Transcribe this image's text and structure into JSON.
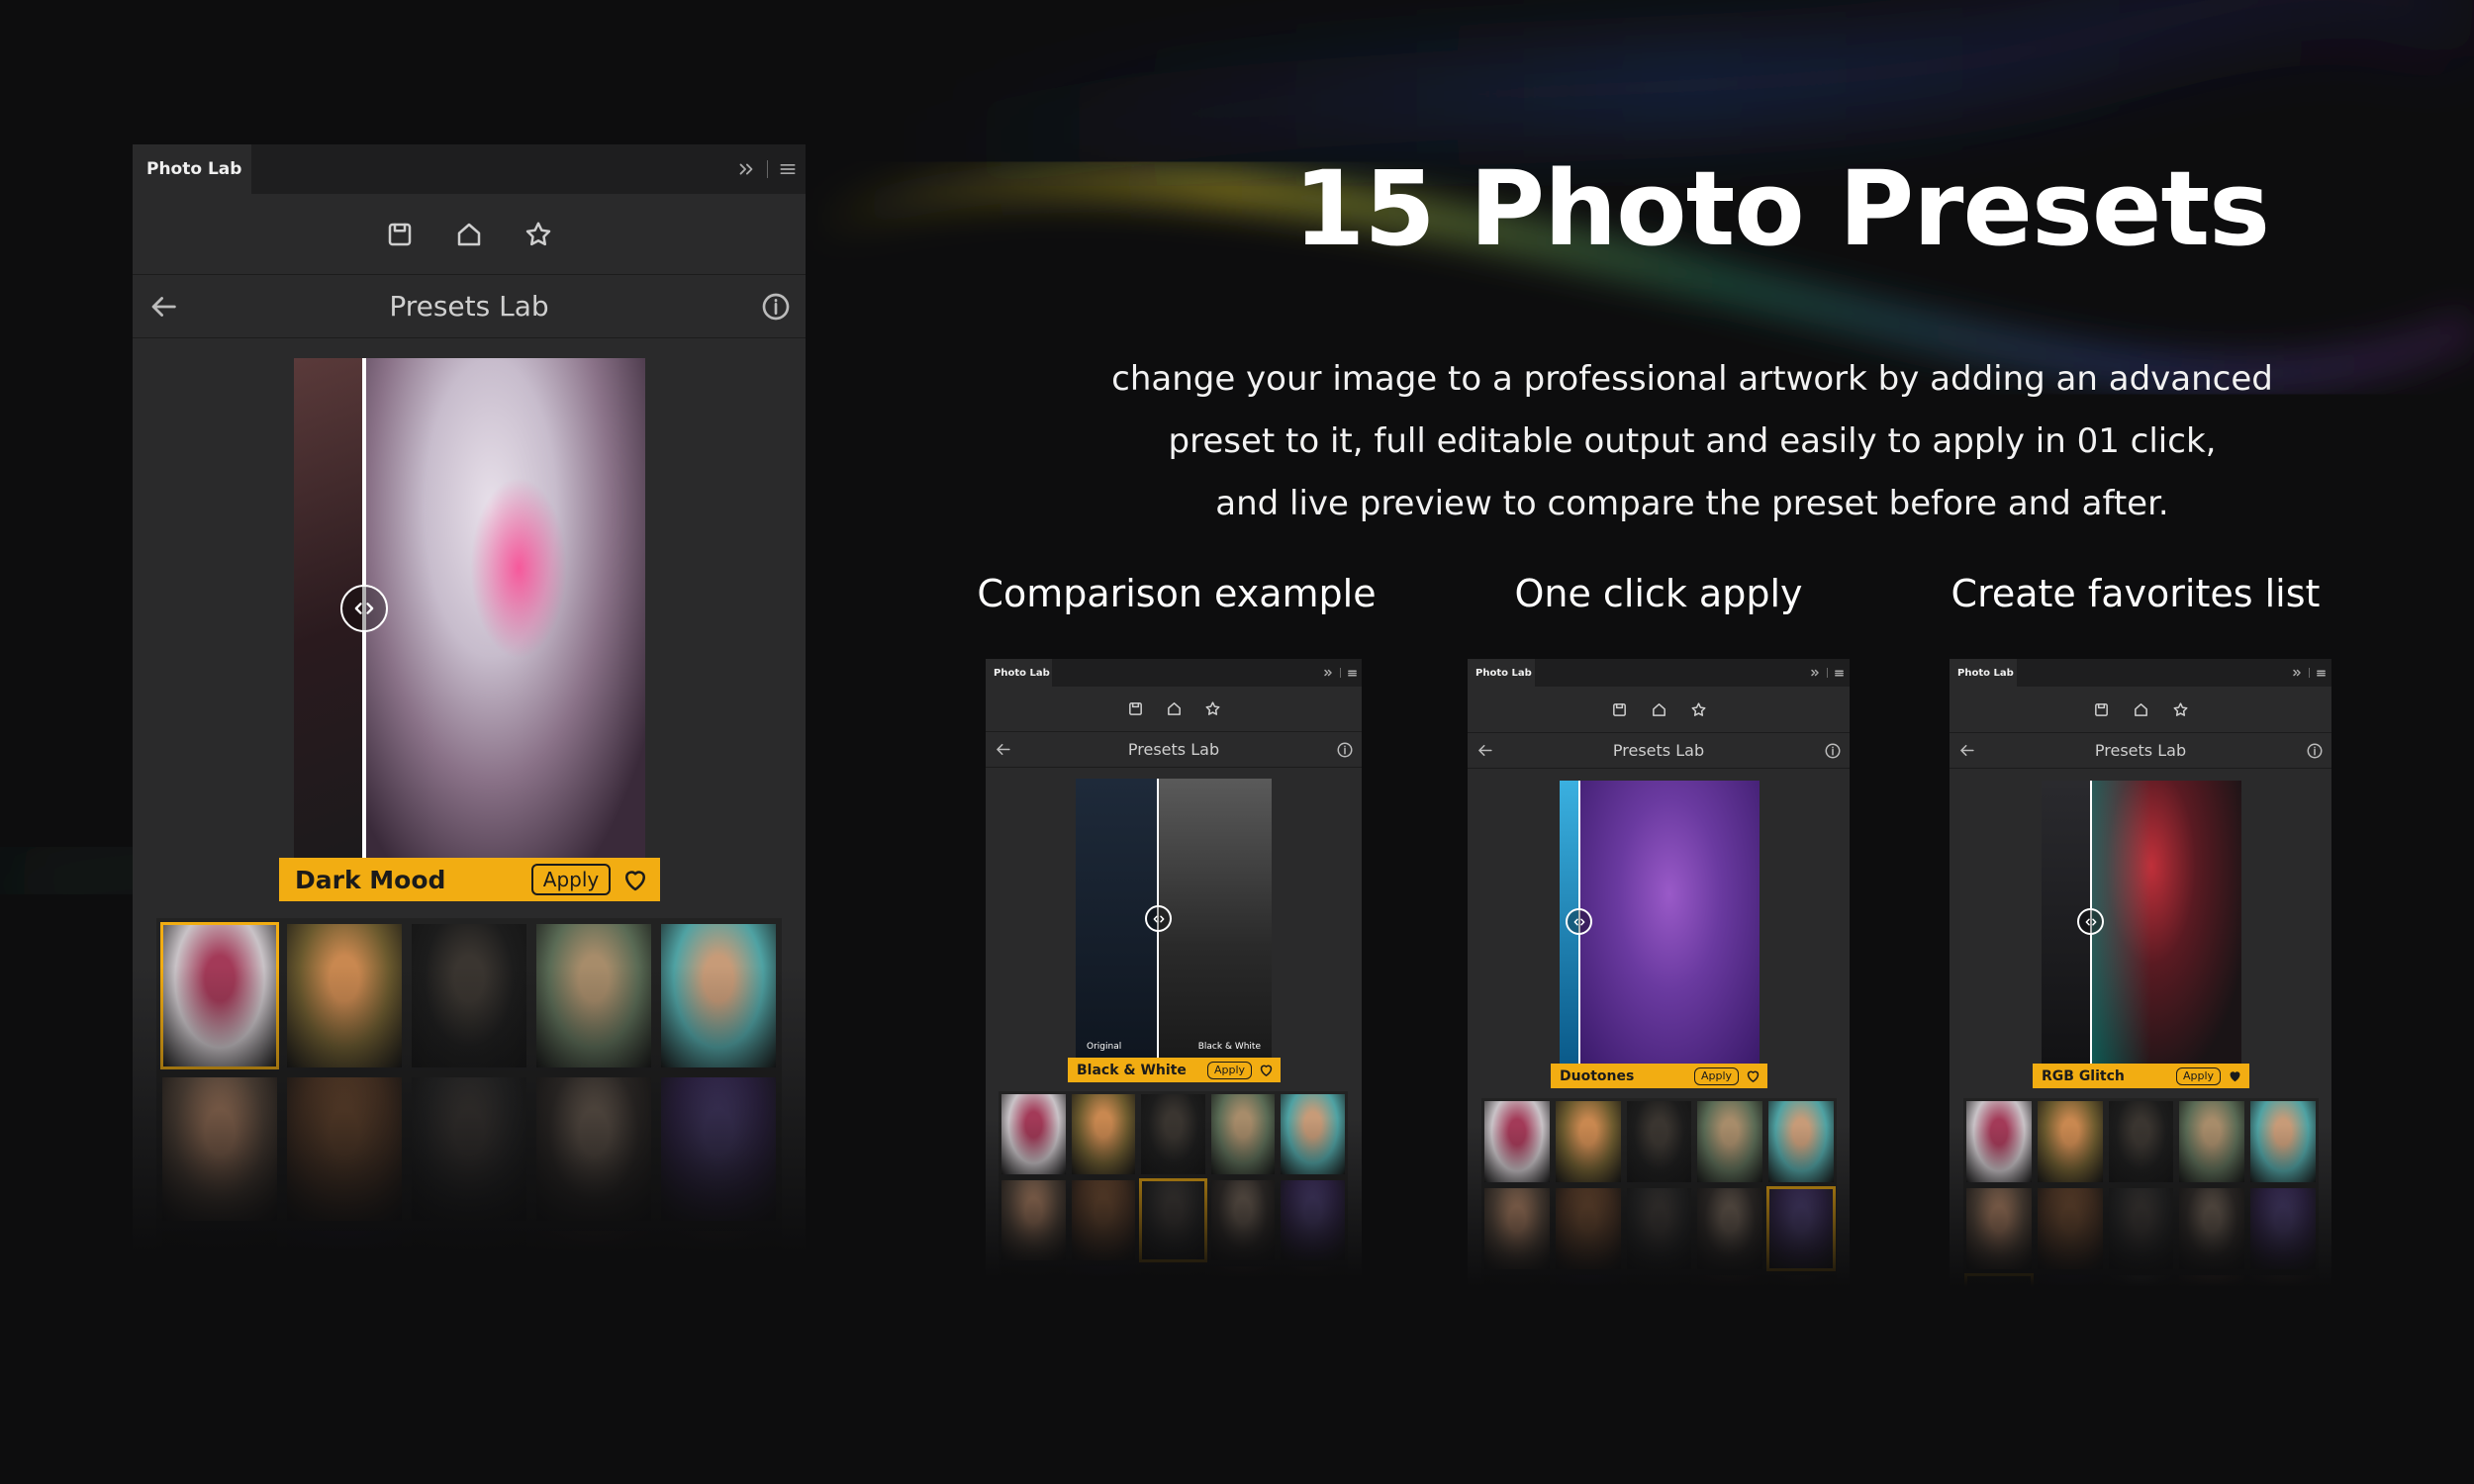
{
  "headline": "15 Photo Presets",
  "description": [
    "change your image to a professional artwork by adding an advanced",
    "preset to it, full editable output and easily to apply in 01 click,",
    "and live preview to compare the preset before and after."
  ],
  "features": [
    {
      "label": "Comparison example"
    },
    {
      "label": "One click apply"
    },
    {
      "label": "Create favorites list"
    }
  ],
  "colors": {
    "accent": "#f2ad12",
    "panel_bg": "#2a2a2b",
    "page_bg": "#0d0d0e"
  },
  "icons": {
    "toolbar": [
      "save-icon",
      "home-icon",
      "star-icon"
    ],
    "header": [
      "back-arrow-icon",
      "info-icon"
    ],
    "tab_menu": [
      "chevron-double-right-icon",
      "hamburger-menu-icon"
    ],
    "preset_bar": [
      "heart-icon"
    ]
  },
  "panels": [
    {
      "tab_title": "Photo Lab",
      "panel_title": "Presets Lab",
      "preset_name": "Dark Mood",
      "apply_label": "Apply",
      "favorite": false,
      "split_ratio": 0.2,
      "before_label": "",
      "after_label": "",
      "thumb_palettes": [
        [
          "#c9c3c7",
          "#a33a58"
        ],
        [
          "#6b5a2e",
          "#c98850"
        ],
        [
          "#1c1c1c",
          "#3a3530"
        ],
        [
          "#5a6b55",
          "#a78c6a"
        ],
        [
          "#4fa2a3",
          "#c79b78"
        ],
        [
          "#6c5848",
          "#d9a07a"
        ],
        [
          "#5e3f2a",
          "#8a5c3a"
        ],
        [
          "#2b2b2b",
          "#4a4440"
        ],
        [
          "#3a3430",
          "#8a7868"
        ],
        [
          "#3a2a5a",
          "#5a4a8a"
        ],
        [
          "#1a1a1a",
          "#2a2330"
        ],
        [
          "#241a3a",
          "#3a2a5a"
        ],
        [
          "#1e1e1e",
          "#2e2e2e"
        ],
        [
          "#3a2a26",
          "#6a4a3a"
        ],
        [
          "#2a2626",
          "#5a4a3a"
        ]
      ],
      "selected_index": 0
    },
    {
      "tab_title": "Photo Lab",
      "panel_title": "Presets Lab",
      "preset_name": "Black & White",
      "apply_label": "Apply",
      "favorite": false,
      "split_ratio": 0.42,
      "before_label": "Original",
      "after_label": "Black & White",
      "thumb_palettes": [
        [
          "#c9c3c7",
          "#a33a58"
        ],
        [
          "#6b5a2e",
          "#c98850"
        ],
        [
          "#1c1c1c",
          "#3a3530"
        ],
        [
          "#5a6b55",
          "#a78c6a"
        ],
        [
          "#4fa2a3",
          "#c79b78"
        ],
        [
          "#6c5848",
          "#d9a07a"
        ],
        [
          "#5e3f2a",
          "#8a5c3a"
        ],
        [
          "#2b2b2b",
          "#4a4440"
        ],
        [
          "#3a3430",
          "#8a7868"
        ],
        [
          "#3a2a5a",
          "#5a4a8a"
        ],
        [
          "#1a1a1a",
          "#2a2330"
        ],
        [
          "#241a3a",
          "#3a2a5a"
        ],
        [
          "#1e1e1e",
          "#2e2e2e"
        ],
        [
          "#3a2a26",
          "#6a4a3a"
        ],
        [
          "#2a2626",
          "#5a4a3a"
        ]
      ],
      "selected_index": 7
    },
    {
      "tab_title": "Photo Lab",
      "panel_title": "Presets Lab",
      "preset_name": "Duotones",
      "apply_label": "Apply",
      "favorite": false,
      "split_ratio": 0.1,
      "before_label": "",
      "after_label": "",
      "thumb_palettes": [
        [
          "#c9c3c7",
          "#a33a58"
        ],
        [
          "#6b5a2e",
          "#c98850"
        ],
        [
          "#1c1c1c",
          "#3a3530"
        ],
        [
          "#5a6b55",
          "#a78c6a"
        ],
        [
          "#4fa2a3",
          "#c79b78"
        ],
        [
          "#6c5848",
          "#d9a07a"
        ],
        [
          "#5e3f2a",
          "#8a5c3a"
        ],
        [
          "#2b2b2b",
          "#4a4440"
        ],
        [
          "#3a3430",
          "#8a7868"
        ],
        [
          "#3a2a5a",
          "#5a4a8a"
        ],
        [
          "#1a1a1a",
          "#2a2330"
        ],
        [
          "#241a3a",
          "#3a2a5a"
        ],
        [
          "#1e1e1e",
          "#2e2e2e"
        ],
        [
          "#3a2a26",
          "#6a4a3a"
        ],
        [
          "#2a2626",
          "#5a4a3a"
        ]
      ],
      "selected_index": 9
    },
    {
      "tab_title": "Photo Lab",
      "panel_title": "Presets Lab",
      "preset_name": "RGB Glitch",
      "apply_label": "Apply",
      "favorite": true,
      "split_ratio": 0.25,
      "before_label": "",
      "after_label": "",
      "thumb_palettes": [
        [
          "#c9c3c7",
          "#a33a58"
        ],
        [
          "#6b5a2e",
          "#c98850"
        ],
        [
          "#1c1c1c",
          "#3a3530"
        ],
        [
          "#5a6b55",
          "#a78c6a"
        ],
        [
          "#4fa2a3",
          "#c79b78"
        ],
        [
          "#6c5848",
          "#d9a07a"
        ],
        [
          "#5e3f2a",
          "#8a5c3a"
        ],
        [
          "#2b2b2b",
          "#4a4440"
        ],
        [
          "#3a3430",
          "#8a7868"
        ],
        [
          "#3a2a5a",
          "#5a4a8a"
        ],
        [
          "#1a1a1a",
          "#2a2330"
        ],
        [
          "#241a3a",
          "#3a2a5a"
        ],
        [
          "#3a3a3a",
          "#a0a0a0"
        ],
        [
          "#6a4a3a",
          "#c08a6a"
        ],
        [
          "#4a3a3a",
          "#a07a5a"
        ]
      ],
      "selected_index": 10
    }
  ]
}
